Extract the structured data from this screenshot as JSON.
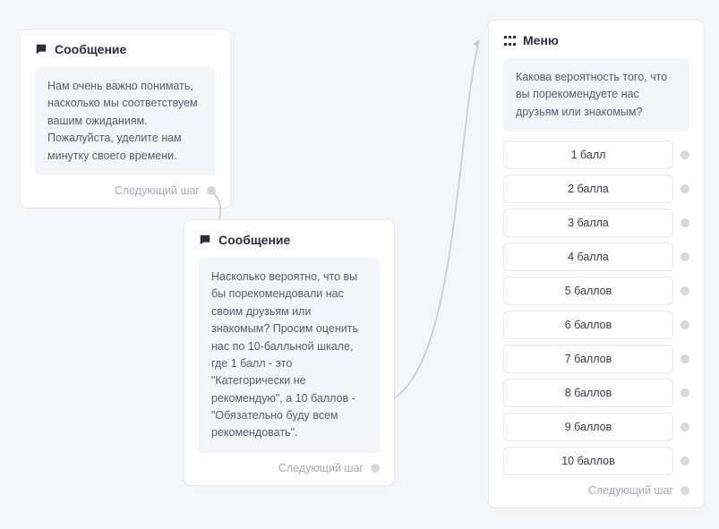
{
  "cards": {
    "msg1": {
      "title": "Сообщение",
      "body": "Нам очень важно понимать, насколько мы соответствуем вашим ожиданиям. Пожалуйста, уделите нам минутку своего времени.",
      "next": "Следующий шаг"
    },
    "msg2": {
      "title": "Сообщение",
      "body": "Насколько вероятно, что вы бы порекомендовали нас своим друзьям или знакомым? Просим оценить нас по 10-балльной шкале, где 1 балл - это \"Категорически не рекомендую\", а 10 баллов - \"Обязательно буду всем рекомендовать\".",
      "next": "Следующий шаг"
    },
    "menu": {
      "title": "Меню",
      "body": "Какова вероятность того, что вы порекомендуете нас друзьям или знакомым?",
      "options": [
        "1 балл",
        "2 балла",
        "3 балла",
        "4 балла",
        "5 баллов",
        "6 баллов",
        "7 баллов",
        "8 баллов",
        "9 баллов",
        "10 баллов"
      ],
      "next": "Следующий шаг"
    }
  }
}
